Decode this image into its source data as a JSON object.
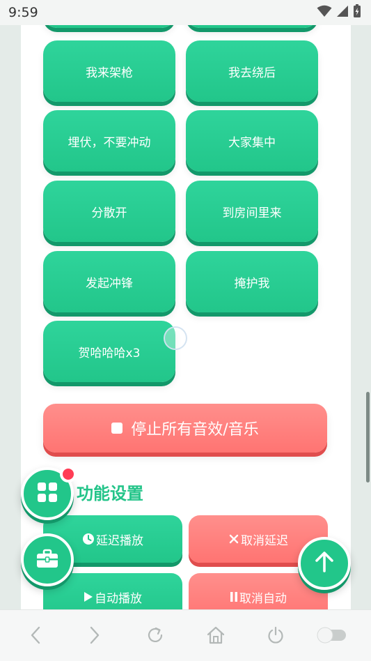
{
  "status_bar": {
    "time": "9:59"
  },
  "buttons": [
    {
      "label": "我来架枪"
    },
    {
      "label": "我去绕后"
    },
    {
      "label": "埋伏，不要冲动"
    },
    {
      "label": "大家集中"
    },
    {
      "label": "分散开"
    },
    {
      "label": "到房间里来"
    },
    {
      "label": "发起冲锋"
    },
    {
      "label": "掩护我"
    },
    {
      "label": "贺哈哈哈x3"
    }
  ],
  "stop_button": {
    "label": "停止所有音效/音乐"
  },
  "section": {
    "title": "功能设置"
  },
  "function_buttons": [
    {
      "label": "延迟播放"
    },
    {
      "label": "取消延迟"
    },
    {
      "label": "自动播放"
    },
    {
      "label": "取消自动"
    }
  ],
  "colors": {
    "accent_green": "#22c68a",
    "accent_red": "#ff7472",
    "badge_red": "#ff3d55"
  },
  "icons": {
    "apps_fab": "grid-icon",
    "tools_fab": "toolbox-icon",
    "top_fab": "arrow-up-icon"
  }
}
